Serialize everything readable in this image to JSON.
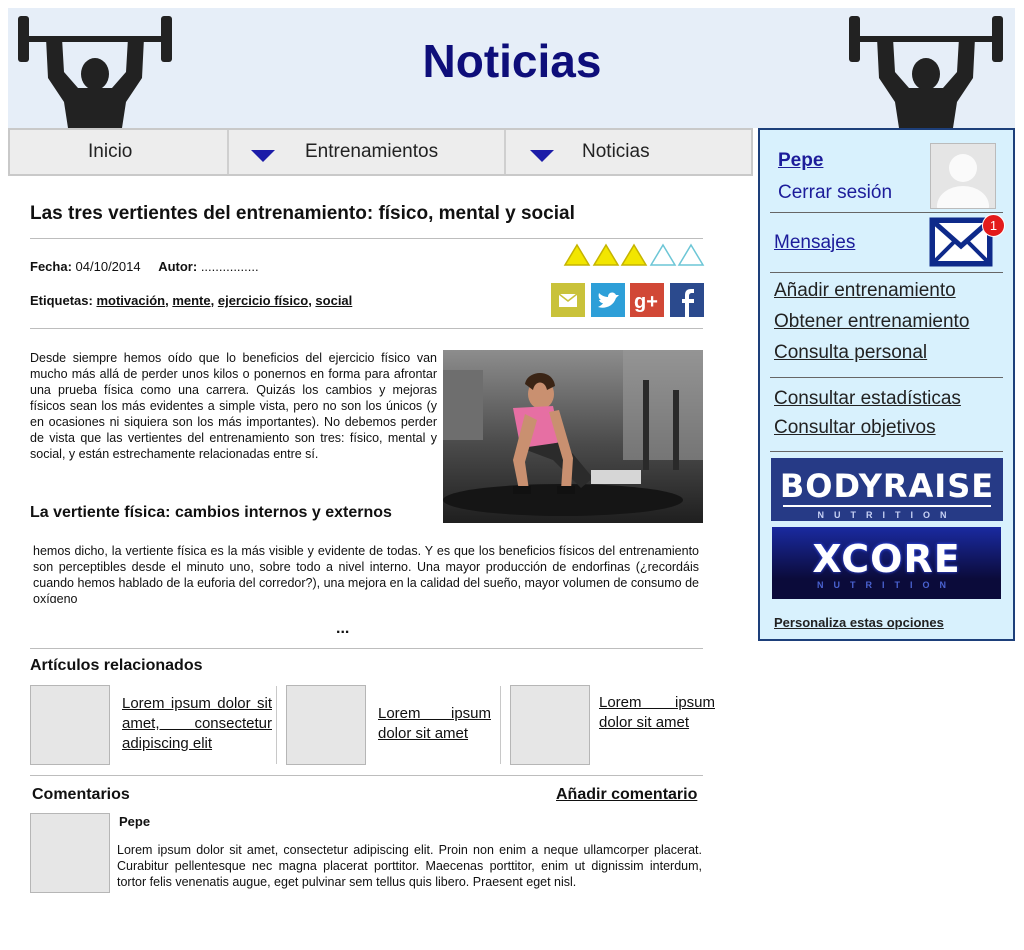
{
  "header": {
    "title": "Noticias"
  },
  "nav": {
    "items": [
      "Inicio",
      "Entrenamientos",
      "Noticias"
    ]
  },
  "sidebar": {
    "user": "Pepe",
    "logout": "Cerrar sesión",
    "messages": "Mensajes",
    "messages_badge": "1",
    "links_group1": [
      "Añadir entrenamiento",
      "Obtener entrenamiento",
      "Consulta personal"
    ],
    "links_group2": [
      "Consultar estadísticas",
      "Consultar objetivos"
    ],
    "banners": [
      {
        "name": "BODYRAISE",
        "sub": "NUTRITION"
      },
      {
        "name": "XCORE",
        "sub": "NUTRITION"
      }
    ],
    "customize": "Personaliza estas opciones"
  },
  "article": {
    "title": "Las tres vertientes del entrenamiento: físico, mental y social",
    "date_label": "Fecha:",
    "date": "04/10/2014",
    "author_label": "Autor:",
    "author": "................",
    "tags_label": "Etiquetas:",
    "tags": [
      "motivación",
      "mente",
      "ejercicio físico",
      "social"
    ],
    "rating": {
      "filled": 3,
      "total": 5
    },
    "intro": "Desde siempre hemos oído que lo beneficios del ejercicio físico van mucho más allá de perder unos kilos o ponernos en forma para afrontar una prueba física como una carrera. Quizás los cambios y mejoras físicos sean los más evidentes a simple vista, pero no son los únicos (y en ocasiones ni siquiera son los más importantes). No debemos perder de vista que las vertientes del entrenamiento son tres: físico, mental y social, y están estrechamente relacionadas entre sí.",
    "subheading": "La vertiente física: cambios internos y externos",
    "paragraph2": " hemos dicho, la vertiente física es la más visible y evidente de todas. Y es que los beneficios físicos del entrenamiento son perceptibles desde el minuto uno, sobre todo a nivel interno. Una mayor producción de endorfinas (¿recordáis cuando hemos hablado de la euforia del corredor?), una mejora en la calidad del sueño, mayor volumen de consumo de oxígeno",
    "more": "..."
  },
  "related": {
    "title": "Artículos relacionados",
    "items": [
      " Lorem ipsum dolor sit amet, consectetur adipiscing elit",
      " Lorem ipsum dolor sit amet",
      " Lorem ipsum dolor sit amet"
    ]
  },
  "comments": {
    "title": "Comentarios",
    "add": "Añadir comentario",
    "items": [
      {
        "author": "Pepe",
        "text": " Lorem ipsum dolor sit amet, consectetur adipiscing elit. Proin non enim a neque ullamcorper placerat. Curabitur pellentesque nec magna placerat porttitor. Maecenas porttitor, enim ut dignissim interdum, tortor felis venenatis augue, eget pulvinar sem tellus quis libero. Praesent eget nisl."
      }
    ]
  },
  "colors": {
    "title": "#0e0e7a",
    "sidebar_bg": "#d8f1fd",
    "header_bg": "#e6eef8",
    "nav_arrow": "#1c1ca8",
    "star": "#f2e600"
  },
  "icons": [
    "weightlifter-logo",
    "weightlifter-logo",
    "nav-arrow-down",
    "nav-arrow-down",
    "avatar",
    "mail-icon",
    "rating-star",
    "email-share-icon",
    "twitter-icon",
    "google-plus-icon",
    "facebook-icon"
  ]
}
